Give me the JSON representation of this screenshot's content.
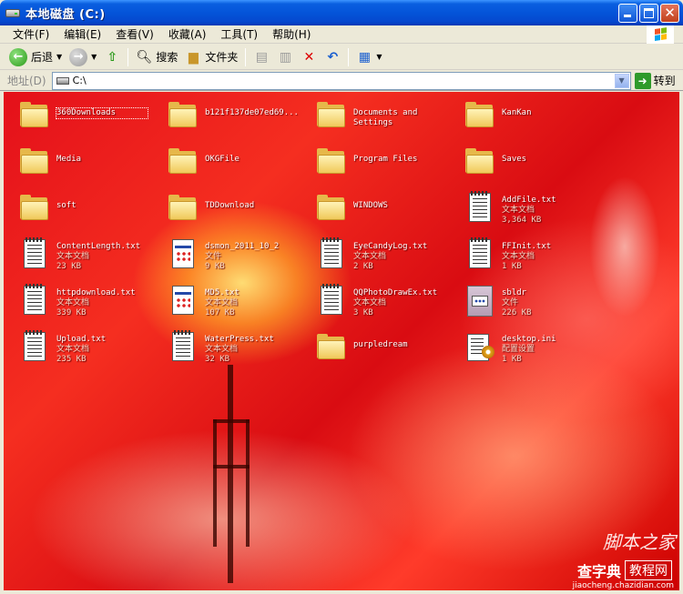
{
  "window": {
    "title": "本地磁盘 (C:)"
  },
  "menu": [
    "文件(F)",
    "编辑(E)",
    "查看(V)",
    "收藏(A)",
    "工具(T)",
    "帮助(H)"
  ],
  "toolbar": {
    "back_label": "后退",
    "search_label": "搜索",
    "folders_label": "文件夹"
  },
  "address": {
    "label": "地址(D)",
    "path": "C:\\",
    "go_label": "转到"
  },
  "items": [
    {
      "name": "360Downloads",
      "type": "folder",
      "selected": true
    },
    {
      "name": "b121f137de07ed69...",
      "type": "folder"
    },
    {
      "name": "Documents and Settings",
      "type": "folder"
    },
    {
      "name": "KanKan",
      "type": "folder"
    },
    {
      "name": "Media",
      "type": "folder"
    },
    {
      "name": "OKGFile",
      "type": "folder"
    },
    {
      "name": "Program Files",
      "type": "folder"
    },
    {
      "name": "Saves",
      "type": "folder"
    },
    {
      "name": "soft",
      "type": "folder"
    },
    {
      "name": "TDDownload",
      "type": "folder"
    },
    {
      "name": "WINDOWS",
      "type": "folder"
    },
    {
      "name": "AddFile.txt",
      "type": "txt",
      "kind": "文本文档",
      "size": "3,364 KB"
    },
    {
      "name": "ContentLength.txt",
      "type": "txt",
      "kind": "文本文档",
      "size": "23 KB"
    },
    {
      "name": "dsmon_2011_10_2",
      "type": "app",
      "kind": "文件",
      "size": "9 KB"
    },
    {
      "name": "EyeCandyLog.txt",
      "type": "txt",
      "kind": "文本文档",
      "size": "2 KB"
    },
    {
      "name": "FFInit.txt",
      "type": "txt",
      "kind": "文本文档",
      "size": "1 KB"
    },
    {
      "name": "httpdownload.txt",
      "type": "txt",
      "kind": "文本文档",
      "size": "339 KB"
    },
    {
      "name": "MD5.txt",
      "type": "app",
      "kind": "文本文档",
      "size": "107 KB"
    },
    {
      "name": "QQPhotoDrawEx.txt",
      "type": "txt",
      "kind": "文本文档",
      "size": "3 KB"
    },
    {
      "name": "sbldr",
      "type": "bin",
      "kind": "文件",
      "size": "226 KB"
    },
    {
      "name": "Upload.txt",
      "type": "txt",
      "kind": "文本文档",
      "size": "235 KB"
    },
    {
      "name": "WaterPress.txt",
      "type": "txt",
      "kind": "文本文档",
      "size": "32 KB"
    },
    {
      "name": "purpledream",
      "type": "folder"
    },
    {
      "name": "desktop.ini",
      "type": "ini",
      "kind": "配置设置",
      "size": "1 KB"
    }
  ],
  "watermark": {
    "line1": "脚本之家",
    "line2a": "查字典",
    "line2b": "教程网",
    "line3": "jiaocheng.chazidian.com"
  }
}
